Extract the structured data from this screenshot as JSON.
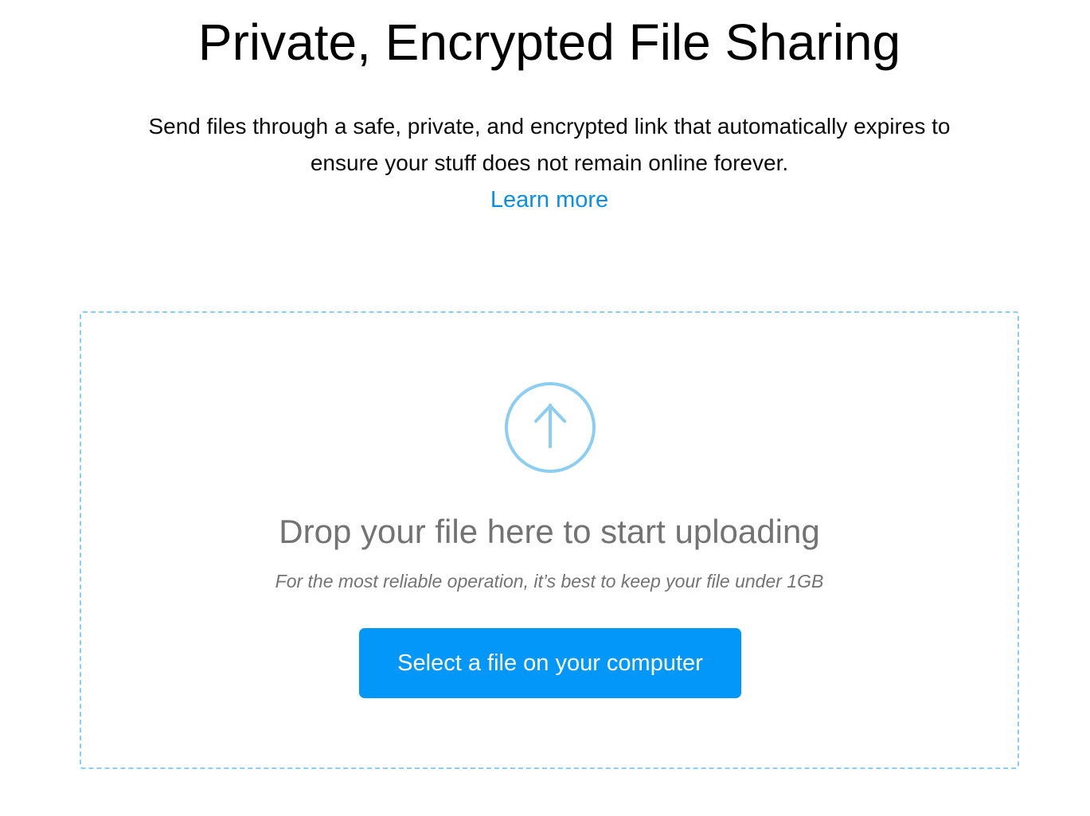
{
  "header": {
    "title": "Private, Encrypted File Sharing",
    "description": "Send files through a safe, private, and encrypted link that automatically expires to ensure your stuff does not remain online forever.",
    "learn_more_label": "Learn more"
  },
  "upload": {
    "icon": "upload-arrow-icon",
    "heading": "Drop your file here to start uploading",
    "note": "For the most reliable operation, it’s best to keep your file under 1GB",
    "button_label": "Select a file on your computer"
  },
  "colors": {
    "accent": "#0297f8",
    "link": "#0a8fe6",
    "dropzone_border": "#8ccdf2",
    "icon": "#8ccdf2",
    "muted_text": "#737373"
  }
}
